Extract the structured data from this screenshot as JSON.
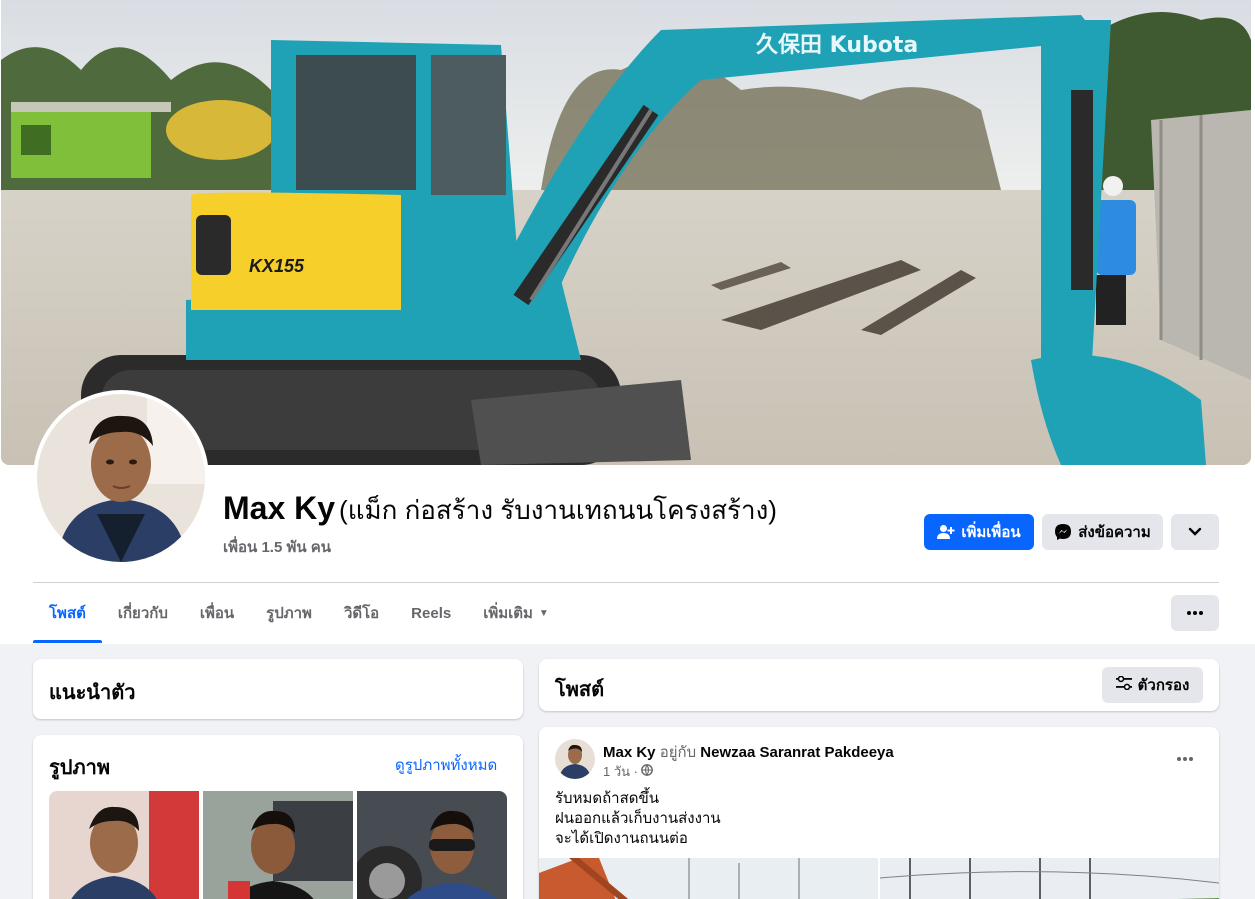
{
  "profile": {
    "name": "Max Ky",
    "alt_name": "(แม็ก ก่อสร้าง รับงานเทถนนโครงสร้าง)",
    "friends": "เพื่อน 1.5 พัน คน"
  },
  "cover": {
    "machine_brand_text": "久保田 Kubota",
    "model_text": "KX155"
  },
  "actions": {
    "add_friend": "เพิ่มเพื่อน",
    "message": "ส่งข้อความ"
  },
  "tabs": [
    "โพสต์",
    "เกี่ยวกับ",
    "เพื่อน",
    "รูปภาพ",
    "วิดีโอ",
    "Reels",
    "เพิ่มเติม"
  ],
  "intro": {
    "title": "แนะนำตัว"
  },
  "photos": {
    "title": "รูปภาพ",
    "see_all": "ดูรูปภาพทั้งหมด"
  },
  "posts": {
    "title": "โพสต์",
    "filter_label": "ตัวกรอง",
    "post": {
      "author": "Max Ky",
      "with_text": "อยู่กับ",
      "tagged": "Newzaa Saranrat Pakdeeya",
      "time": "1 วัน ·",
      "lines": [
        "รับหมดถ้าสดขึ้น",
        "ฝนออกแล้วเก็บงานส่งงาน",
        "จะได้เปิดงานถนนต่อ"
      ]
    }
  },
  "colors": {
    "accent": "#0866ff",
    "excavator_teal": "#1fa2b6",
    "excavator_yellow": "#f6cf2a",
    "page_bg": "#f0f2f5"
  },
  "icons": [
    "add-friend-icon",
    "messenger-icon",
    "chevron-down-icon",
    "more-dots-icon",
    "filter-icon",
    "globe-icon"
  ]
}
